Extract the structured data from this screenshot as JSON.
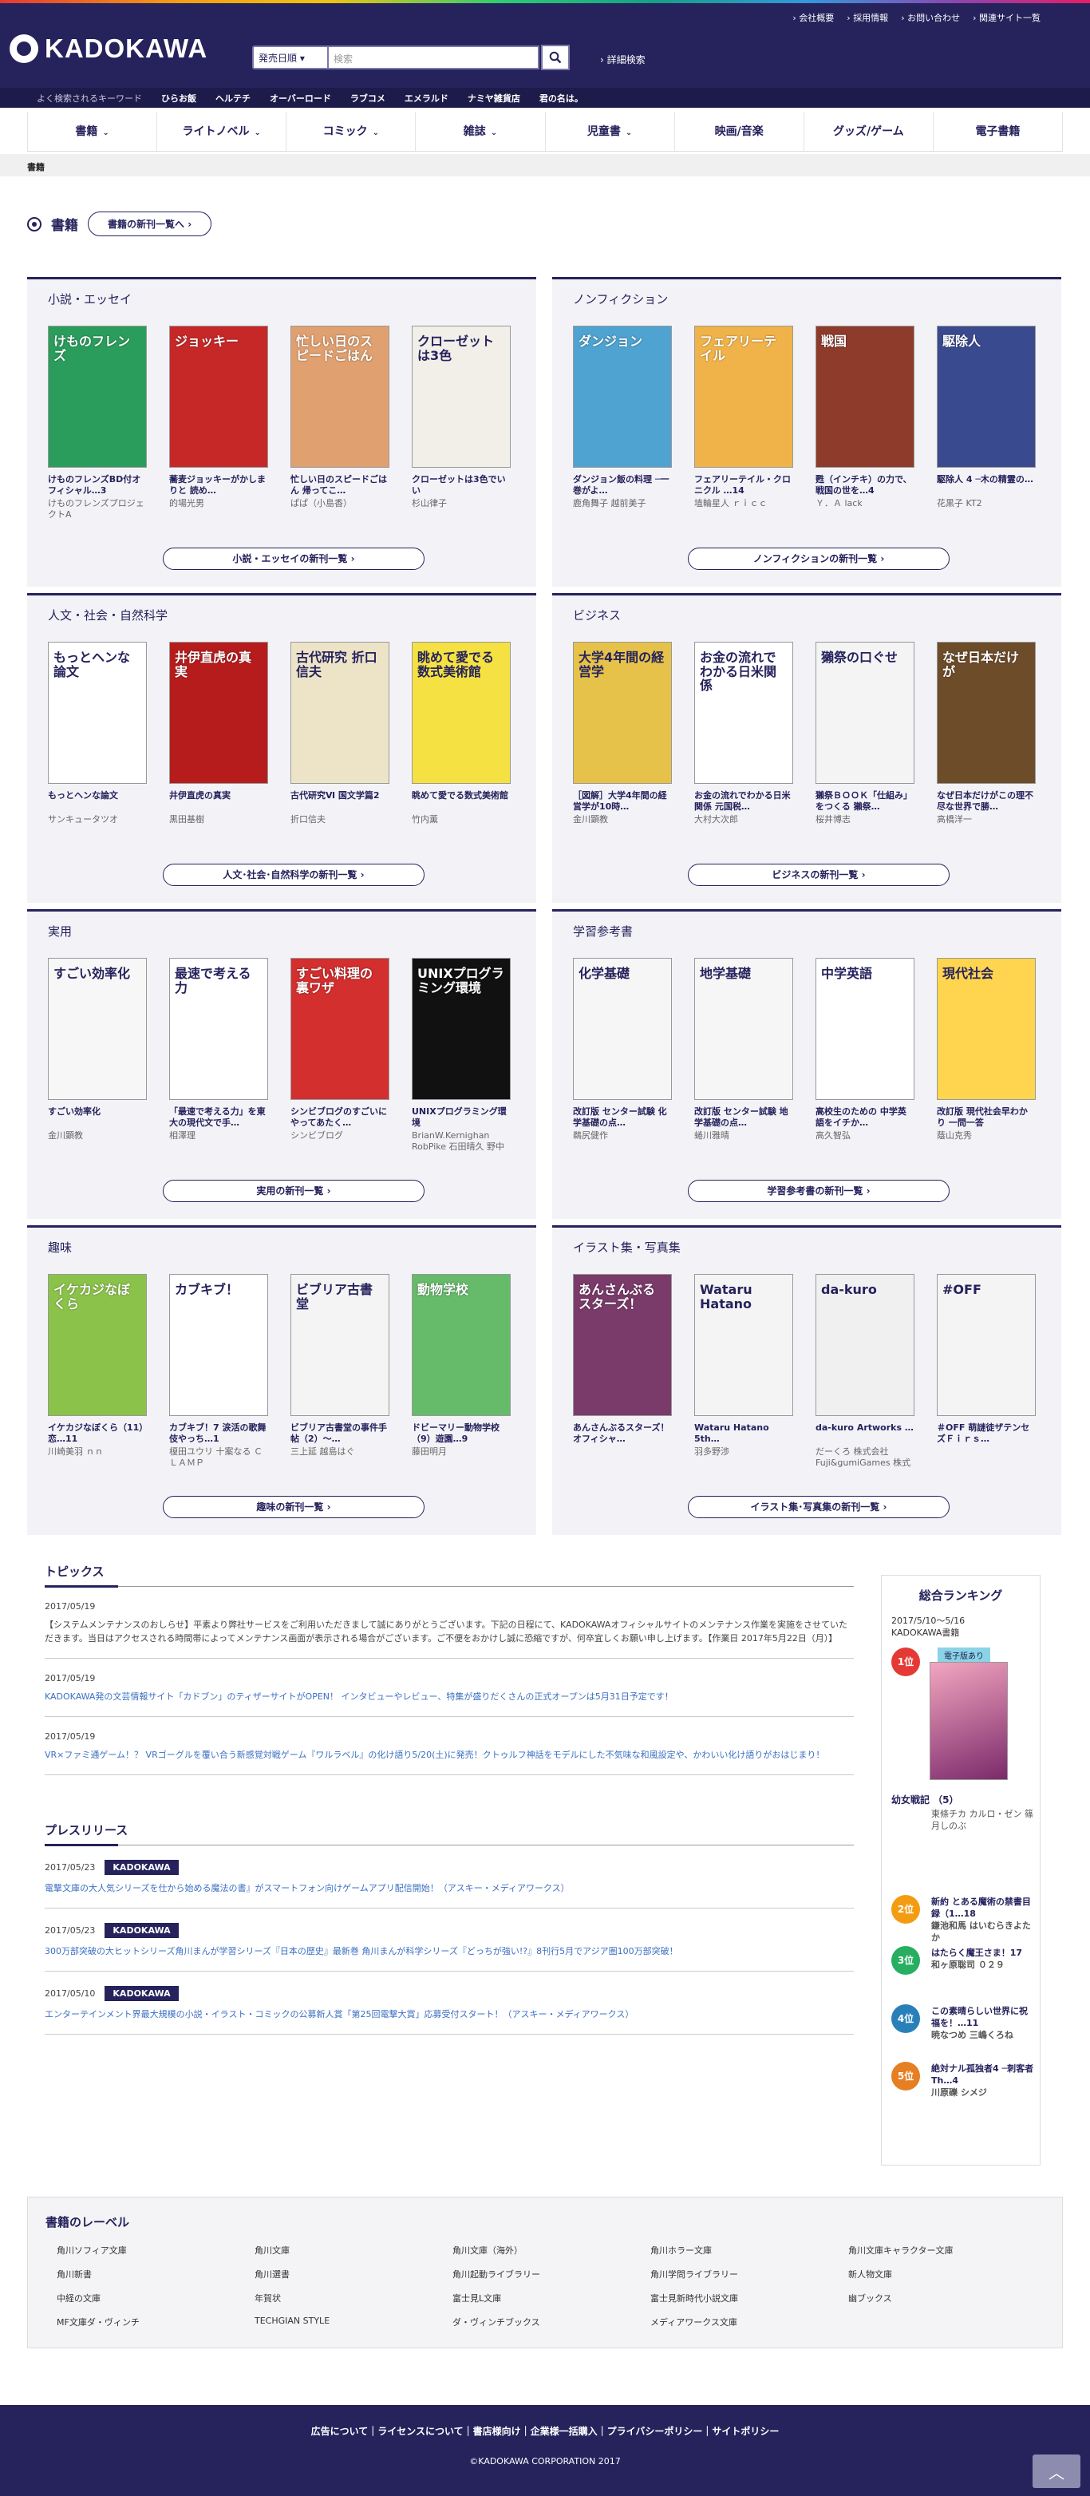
{
  "header": {
    "util_links": [
      "会社概要",
      "採用情報",
      "お問い合わせ",
      "関連サイト一覧"
    ],
    "logo": "KADOKAWA",
    "search_select": "発売日順",
    "search_placeholder": "検索",
    "advanced_search": "詳細検索",
    "keywords_label": "よく検索されるキーワード",
    "keywords": [
      "ひらお飯",
      "ヘルテチ",
      "オーバーロード",
      "ラブコメ",
      "エメラルド",
      "ナミヤ雑貨店",
      "君の名は。"
    ]
  },
  "gnav": [
    {
      "label": "書籍",
      "drop": true
    },
    {
      "label": "ライトノベル",
      "drop": true
    },
    {
      "label": "コミック",
      "drop": true
    },
    {
      "label": "雑誌",
      "drop": true
    },
    {
      "label": "児童書",
      "drop": true
    },
    {
      "label": "映画/音楽",
      "drop": false
    },
    {
      "label": "グッズ/ゲーム",
      "drop": false
    },
    {
      "label": "電子書籍",
      "drop": false
    }
  ],
  "breadcrumb": "書籍",
  "page": {
    "title": "書籍",
    "new_list": "書籍の新刊一覧へ"
  },
  "sections": [
    {
      "title": "小説・エッセイ",
      "more": "小説・エッセイの新刊一覧",
      "books": [
        {
          "title": "けものフレンズBD付オフィシャル…3",
          "author": "けものフレンズプロジェクトA",
          "color": "#2a9d5c",
          "text": "けものフレンズ"
        },
        {
          "title": "蕎麦ジョッキーがかしまりと 読め…",
          "author": "的場光男",
          "color": "#c62828",
          "text": "ジョッキー"
        },
        {
          "title": "忙しい日のスピードごはん 帰ってこ…",
          "author": "ぱぱ（小島香）",
          "color": "#e0a070",
          "text": "忙しい日のスピードごはん"
        },
        {
          "title": "クローゼットは3色でいい",
          "author": "杉山律子",
          "color": "#f2efe9",
          "text": "クローゼットは3色"
        }
      ]
    },
    {
      "title": "ノンフィクション",
      "more": "ノンフィクションの新刊一覧",
      "books": [
        {
          "title": "ダンジョン飯の料理 ─一巻がよ…",
          "author": "鹿角舞子 越前美子",
          "color": "#4fa3d1",
          "text": "ダンジョン"
        },
        {
          "title": "フェアリーテイル・クロニクル …14",
          "author": "埴輪星人 ｒｉｃｃ",
          "color": "#f0b34a",
          "text": "フェアリーテイル"
        },
        {
          "title": "甦（インチキ）の力で、戦国の世を…4",
          "author": "Ｙ．Ａ lack",
          "color": "#8e3b2c",
          "text": "戦国"
        },
        {
          "title": "駆除人 4 ─木の精霊の…",
          "author": "花黒子 KT2",
          "color": "#3a4a8e",
          "text": "駆除人"
        }
      ]
    },
    {
      "title": "人文・社会・自然科学",
      "more": "人文･社会･自然科学の新刊一覧",
      "books": [
        {
          "title": "もっとヘンな論文",
          "author": "サンキュータツオ",
          "color": "#ffffff",
          "text": "もっとヘンな論文"
        },
        {
          "title": "井伊直虎の真実",
          "author": "黒田基樹",
          "color": "#b71c1c",
          "text": "井伊直虎の真実"
        },
        {
          "title": "古代研究Ⅵ 国文学篇2",
          "author": "折口信夫",
          "color": "#ede4c8",
          "text": "古代研究 折口信夫"
        },
        {
          "title": "眺めて愛でる数式美術館",
          "author": "竹内薫",
          "color": "#f5e142",
          "text": "眺めて愛でる数式美術館"
        }
      ]
    },
    {
      "title": "ビジネス",
      "more": "ビジネスの新刊一覧",
      "books": [
        {
          "title": "［図解］大学4年間の経営学が10時…",
          "author": "金川顕教",
          "color": "#e6c24a",
          "text": "大学4年間の経営学"
        },
        {
          "title": "お金の流れでわかる日米関係 元国税…",
          "author": "大村大次郎",
          "color": "#ffffff",
          "text": "お金の流れでわかる日米関係"
        },
        {
          "title": "獺祭ＢＯＯＫ「仕組み」をつくる 獺祭…",
          "author": "桜井博志",
          "color": "#f4f4f4",
          "text": "獺祭の口ぐせ"
        },
        {
          "title": "なぜ日本だけがこの理不尽な世界で勝…",
          "author": "高橋洋一",
          "color": "#6d4c2a",
          "text": "なぜ日本だけが"
        }
      ]
    },
    {
      "title": "実用",
      "more": "実用の新刊一覧",
      "books": [
        {
          "title": "すごい効率化",
          "author": "金川顕教",
          "color": "#f7f7f7",
          "text": "すごい効率化"
        },
        {
          "title": "「最速で考える力」を東大の現代文で手…",
          "author": "相澤理",
          "color": "#ffffff",
          "text": "最速で考える力"
        },
        {
          "title": "シンビブログのすごいにやってあたく…",
          "author": "シンビブログ",
          "color": "#d32f2f",
          "text": "すごい料理の裏ワザ"
        },
        {
          "title": "UNIXプログラミング環境",
          "author": "BrianW.Kernighan RobPike 石田晴久 野中浩一",
          "color": "#111111",
          "text": "UNIXプログラミング環境"
        }
      ]
    },
    {
      "title": "学習参考書",
      "more": "学習参考書の新刊一覧",
      "books": [
        {
          "title": "改訂版 センター試験 化学基礎の点…",
          "author": "鵜尻健作",
          "color": "#f6f6f6",
          "text": "化学基礎"
        },
        {
          "title": "改訂版 センター試験 地学基礎の点…",
          "author": "蜷川雅晴",
          "color": "#f6f6f6",
          "text": "地学基礎"
        },
        {
          "title": "高校生のための 中学英語をイチか…",
          "author": "高久智弘",
          "color": "#ffffff",
          "text": "中学英語"
        },
        {
          "title": "改訂版 現代社会早わかり 一問一答",
          "author": "蔭山克秀",
          "color": "#ffd54f",
          "text": "現代社会"
        }
      ]
    },
    {
      "title": "趣味",
      "more": "趣味の新刊一覧",
      "books": [
        {
          "title": "イケカジなぼくら（11）恋…11",
          "author": "川崎美羽 ｎｎ",
          "color": "#8bc34a",
          "text": "イケカジなぼくら"
        },
        {
          "title": "カブキブ！7 涙活の歌舞伎やっち…1",
          "author": "榎田ユウリ 十案なる ＣＬＡＭＰ",
          "color": "#ffffff",
          "text": "カブキブ！"
        },
        {
          "title": "ビブリア古書堂の事件手帖（2）～…",
          "author": "三上延 越島はぐ",
          "color": "#f4f4f4",
          "text": "ビブリア古書堂"
        },
        {
          "title": "ドビーマリー動物学校（9）遊園…9",
          "author": "藤田明月",
          "color": "#66bb6a",
          "text": "動物学校"
        }
      ]
    },
    {
      "title": "イラスト集・写真集",
      "more": "イラスト集･写真集の新刊一覧",
      "books": [
        {
          "title": "あんさんぶるスターズ！ オフィシャ…",
          "author": "",
          "color": "#7a3a6a",
          "text": "あんさんぶるスターズ！"
        },
        {
          "title": "Wataru Hatano 5th…",
          "author": "羽多野渉",
          "color": "#f4f4f4",
          "text": "Wataru Hatano"
        },
        {
          "title": "da-kuro Artworks …",
          "author": "だーくろ 株式会社Fuji&gumiGames 株式会社gumi",
          "color": "#f0f0f0",
          "text": "da-kuro"
        },
        {
          "title": "＃OFF 萌謎徒ザテンセズＦｉｒｓ…",
          "author": "",
          "color": "#f4f4f4",
          "text": "#OFF"
        }
      ]
    }
  ],
  "topics": {
    "title": "トピックス",
    "items": [
      {
        "date": "2017/05/19",
        "text": "【システムメンテナンスのおしらせ】平素より弊社サービスをご利用いただきまして誠にありがとうございます。下記の日程にて、KADOKAWAオフィシャルサイトのメンテナンス作業を実施をさせていただきます。当日はアクセスされる時間帯によってメンテナンス画面が表示される場合がございます。ご不便をおかけし誠に恐縮ですが、何卒宜しくお願い申し上げます。【作業日 2017年5月22日（月）】",
        "link": false
      },
      {
        "date": "2017/05/19",
        "text": "KADOKAWA発の文芸情報サイト「カドブン」のティザーサイトがOPEN！ インタビューやレビュー、特集が盛りだくさんの正式オープンは5月31日予定です！",
        "link": true
      },
      {
        "date": "2017/05/19",
        "text": "VR×ファミ通ゲーム！？ VRゴーグルを覆い合う新感覚対戦ゲーム『ワルラベル』の化け語り5/20(土)に発売！クトゥルフ神話をモデルにした不気味な和風設定や、かわいい化け語りがおはじまり！",
        "link": true
      }
    ]
  },
  "press": {
    "title": "プレスリリース",
    "items": [
      {
        "date": "2017/05/23",
        "badge": "KADOKAWA",
        "text": "電撃文庫の大人気シリーズを仕から始める魔法の書』がスマートフォン向けゲームアプリ配信開始！（アスキー・メディアワークス）"
      },
      {
        "date": "2017/05/23",
        "badge": "KADOKAWA",
        "text": "300万部突破の大ヒットシリーズ角川まんが学習シリーズ『日本の歴史』最新巻 角川まんが科学シリーズ『どっちが強い!?』8刊行5月でアジア圏100万部突破！"
      },
      {
        "date": "2017/05/10",
        "badge": "KADOKAWA",
        "text": "エンターテインメント界最大規模の小説・イラスト・コミックの公募新人賞「第25回電撃大賞」応募受付スタート！（アスキー・メディアワークス）"
      }
    ]
  },
  "ranking": {
    "title": "総合ランキング",
    "period": "2017/5/10〜5/16",
    "category": "KADOKAWA書籍",
    "ebook_badge": "電子版あり",
    "items": [
      {
        "rank": "1位",
        "title": "幼女戦記 （5）",
        "author": "東條チカ カルロ・ゼン 篠月しのぶ",
        "color": "#e53935"
      },
      {
        "rank": "2位",
        "title": "新約 とある魔術の禁書目録（1…18",
        "author": "鎌池和馬 はいむらきよたか",
        "color": "#f39c12"
      },
      {
        "rank": "3位",
        "title": "はたらく魔王さま！17",
        "author": "和ヶ原聡司 ０２９",
        "color": "#27ae60"
      },
      {
        "rank": "4位",
        "title": "この素晴らしい世界に祝福を！…11",
        "author": "暁なつめ 三嶋くろね",
        "color": "#2980b9"
      },
      {
        "rank": "5位",
        "title": "絶対ナル孤独者4 ─刺客者 Th…4",
        "author": "川原礫 シメジ",
        "color": "#e67e22"
      }
    ]
  },
  "labels": {
    "title": "書籍のレーベル",
    "items": [
      "角川ソフィア文庫",
      "角川文庫",
      "角川文庫（海外）",
      "角川ホラー文庫",
      "角川文庫キャラクター文庫",
      "角川新書",
      "角川選書",
      "角川起動ライブラリー",
      "角川学問ライブラリー",
      "新人物文庫",
      "中経の文庫",
      "年賀状",
      "富士見L文庫",
      "富士見新時代小説文庫",
      "幽ブックス",
      "MF文庫ダ・ヴィンチ",
      "TECHGIAN STYLE",
      "ダ・ヴィンチブックス",
      "メディアワークス文庫",
      ""
    ]
  },
  "footer": {
    "links": "広告について｜ライセンスについて｜書店様向け｜企業様一括購入｜プライバシーポリシー｜サイトポリシー",
    "copyright": "©KADOKAWA CORPORATION 2017",
    "totop": "︿"
  }
}
